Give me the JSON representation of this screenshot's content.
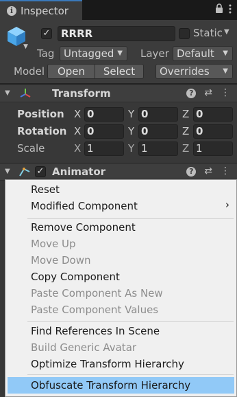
{
  "tab": {
    "title": "Inspector",
    "icon": "info-icon"
  },
  "header": {
    "object_name": "RRRR",
    "active_checked": true,
    "static_label": "Static",
    "tag_label": "Tag",
    "tag_value": "Untagged",
    "layer_label": "Layer",
    "layer_value": "Default",
    "model_label": "Model",
    "open_label": "Open",
    "select_label": "Select",
    "overrides_label": "Overrides"
  },
  "transform": {
    "title": "Transform",
    "rows": [
      {
        "label": "Position",
        "x": "0",
        "y": "0",
        "z": "0"
      },
      {
        "label": "Rotation",
        "x": "0",
        "y": "0",
        "z": "0"
      },
      {
        "label": "Scale",
        "x": "1",
        "y": "1",
        "z": "1"
      }
    ],
    "axis_x": "X",
    "axis_y": "Y",
    "axis_z": "Z"
  },
  "animator": {
    "title": "Animator",
    "enabled": true
  },
  "menu": {
    "items": [
      {
        "label": "Reset",
        "enabled": true
      },
      {
        "label": "Modified Component",
        "enabled": true,
        "submenu": true
      },
      {
        "label": "Remove Component",
        "enabled": true
      },
      {
        "label": "Move Up",
        "enabled": false
      },
      {
        "label": "Move Down",
        "enabled": false
      },
      {
        "label": "Copy Component",
        "enabled": true
      },
      {
        "label": "Paste Component As New",
        "enabled": false
      },
      {
        "label": "Paste Component Values",
        "enabled": false
      },
      {
        "label": "Find References In Scene",
        "enabled": true
      },
      {
        "label": "Build Generic Avatar",
        "enabled": false
      },
      {
        "label": "Optimize Transform Hierarchy",
        "enabled": true
      },
      {
        "label": "Obfuscate Transform Hierarchy",
        "enabled": true,
        "highlighted": true
      }
    ],
    "submenu_arrow": "›",
    "highlight_color": "#91c9f7"
  },
  "colors": {
    "accent": "#3a79bb",
    "panel": "#383838",
    "field": "#2a2a2a"
  }
}
